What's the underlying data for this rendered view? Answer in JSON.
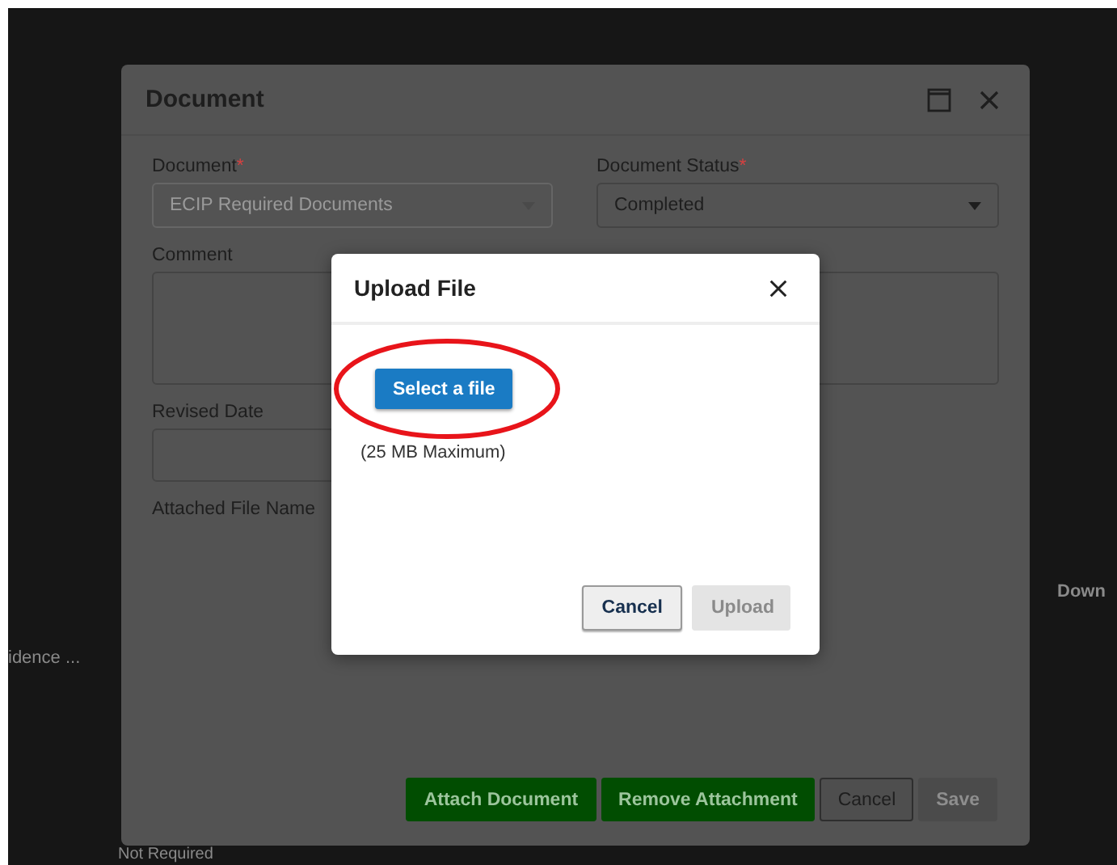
{
  "background_page": {
    "texts": [
      {
        "text": "Down",
        "kind": "header"
      },
      {
        "text": "idence ...",
        "kind": "cell"
      },
      {
        "text": "Not Required",
        "kind": "cell"
      }
    ]
  },
  "document_dialog": {
    "title": "Document",
    "fields": [
      {
        "label": "Document",
        "required_mark": "*",
        "kind": "dropdown",
        "value": "ECIP Required Documents",
        "disabled": true
      },
      {
        "label": "Document Status",
        "required_mark": "*",
        "kind": "dropdown",
        "value": "Completed",
        "disabled": false
      },
      {
        "label": "Comment",
        "kind": "textarea"
      },
      {
        "label": "Revised Date",
        "kind": "input"
      },
      {
        "label": "Attached File Name",
        "kind": "label"
      }
    ],
    "buttons": [
      {
        "label": "Attach Document",
        "kind": "success",
        "disabled": false
      },
      {
        "label": "Remove Attachment",
        "kind": "success",
        "disabled": false
      },
      {
        "label": "Cancel",
        "kind": "default",
        "disabled": false
      },
      {
        "label": "Save",
        "kind": "primary",
        "disabled": true
      }
    ]
  },
  "upload_dialog": {
    "title": "Upload File",
    "select_button": "Select a file",
    "hint": "(25 MB Maximum)",
    "buttons": [
      {
        "label": "Cancel",
        "disabled": false
      },
      {
        "label": "Upload",
        "disabled": true
      }
    ]
  }
}
